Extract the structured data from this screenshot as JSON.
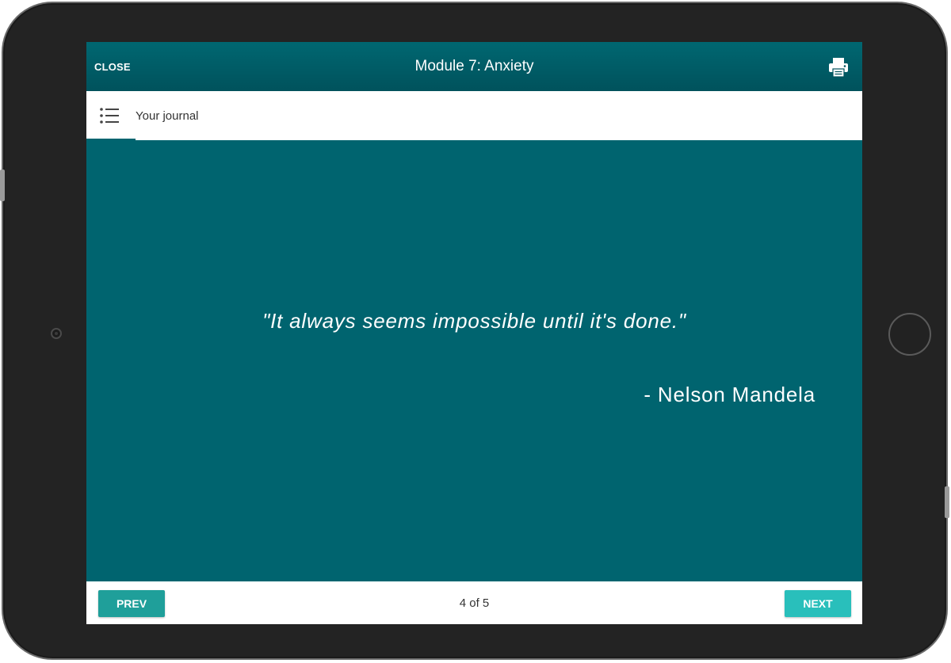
{
  "topbar": {
    "close_label": "CLOSE",
    "title": "Module 7: Anxiety",
    "print_icon": "printer-icon"
  },
  "journal": {
    "menu_icon": "list-icon",
    "label": "Your journal"
  },
  "content": {
    "quote": "\"It always seems impossible until it's done.\"",
    "author": "- Nelson Mandela"
  },
  "footer": {
    "prev_label": "PREV",
    "next_label": "NEXT",
    "page_indicator": "4 of 5"
  },
  "colors": {
    "header": "#005a64",
    "content_bg": "#00646f",
    "button": "#26b2ae",
    "device_frame": "#232323"
  }
}
